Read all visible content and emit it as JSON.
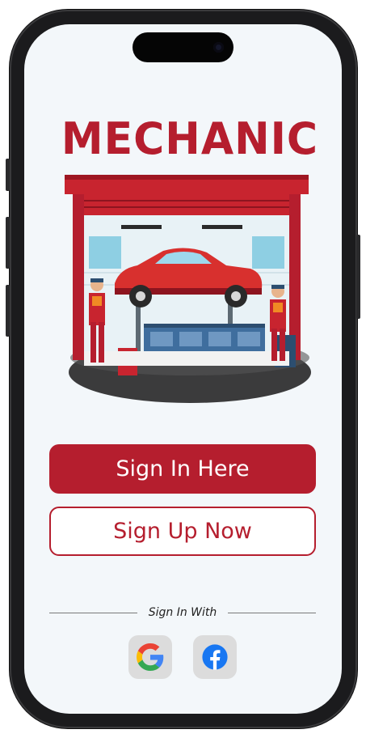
{
  "app": {
    "logo_text": "MECHANIC"
  },
  "actions": {
    "sign_in_label": "Sign In Here",
    "sign_up_label": "Sign Up Now"
  },
  "social": {
    "divider_label": "Sign In With",
    "providers": [
      {
        "name": "Google",
        "icon": "google-icon"
      },
      {
        "name": "Facebook",
        "icon": "facebook-icon"
      }
    ]
  },
  "colors": {
    "brand_red": "#b51e2e",
    "screen_bg": "#f3f7fa",
    "social_button_bg": "#dcdcdc",
    "facebook_blue": "#1877f2"
  }
}
